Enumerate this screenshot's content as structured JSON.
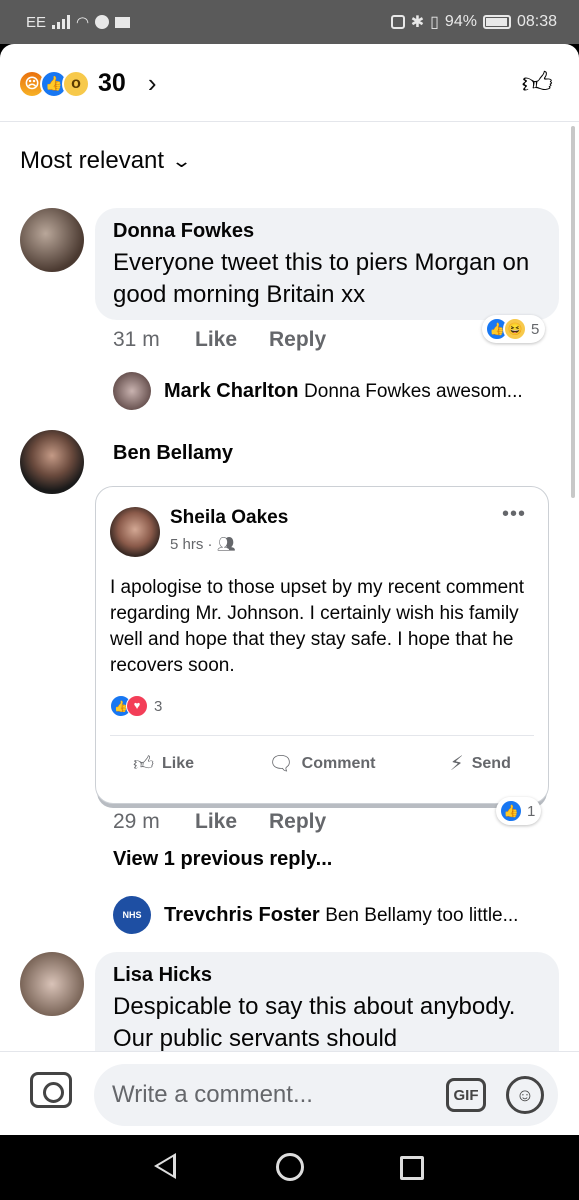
{
  "status_bar": {
    "carrier": "EE",
    "battery": "94%",
    "time": "08:38"
  },
  "header": {
    "reaction_count": "30",
    "chevron": "›"
  },
  "sort": {
    "label": "Most relevant"
  },
  "comments": [
    {
      "author": "Donna Fowkes",
      "text": "Everyone tweet this to piers Morgan on good morning Britain xx",
      "time": "31 m",
      "like_label": "Like",
      "reply_label": "Reply",
      "reaction_count": "5",
      "reply_preview": {
        "author": "Mark Charlton",
        "text": "Donna Fowkes awesom..."
      }
    },
    {
      "author": "Ben Bellamy",
      "shared_post": {
        "author": "Sheila Oakes",
        "meta": "5 hrs ·",
        "text": "I apologise to those upset by my recent comment regarding Mr. Johnson.  I certainly wish his family well and hope that they stay safe.  I hope that he recovers soon.",
        "reaction_count": "3",
        "actions": [
          "Like",
          "Comment",
          "Send"
        ]
      },
      "time": "29 m",
      "like_label": "Like",
      "reply_label": "Reply",
      "reaction_count": "1",
      "view_previous": "View 1 previous reply...",
      "reply_preview": {
        "author": "Trevchris Foster",
        "text": "Ben Bellamy too little..."
      }
    },
    {
      "author": "Lisa Hicks",
      "text": "Despicable to say this about anybody. Our public servants should"
    }
  ],
  "composer": {
    "placeholder": "Write a comment...",
    "gif_label": "GIF"
  },
  "icons": {
    "like": "thumbs-up-icon",
    "comment": "speech-bubble-icon",
    "send": "messenger-icon",
    "camera": "camera-icon",
    "emoji": "smiley-icon"
  },
  "colors": {
    "like_blue": "#1877f2",
    "love_red": "#f33e58",
    "bubble_bg": "#f0f2f5",
    "meta_gray": "#65676b"
  }
}
